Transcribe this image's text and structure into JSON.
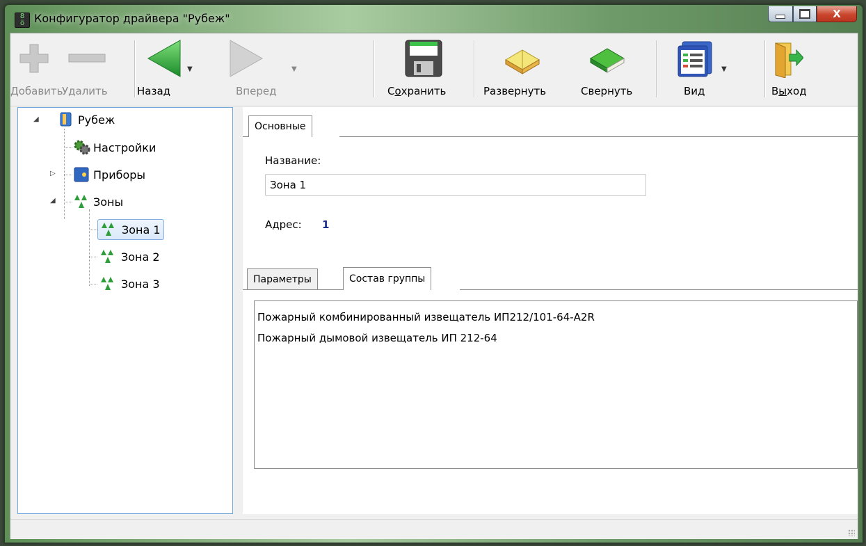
{
  "window": {
    "title": "Конфигуратор драйвера \"Рубеж\"",
    "close_glyph": "X"
  },
  "toolbar": {
    "add": "Добавить",
    "delete": "Удалить",
    "back": "Назад",
    "forward": "Вперед",
    "save_pre": "С",
    "save_u": "о",
    "save_post": "хранить",
    "expand": "Развернуть",
    "collapse": "Свернуть",
    "view": "Вид",
    "exit_pre": "В",
    "exit_u": "ы",
    "exit_post": "ход"
  },
  "tree": {
    "root": "Рубеж",
    "settings": "Настройки",
    "devices": "Приборы",
    "zones": "Зоны",
    "zone_items": [
      "Зона 1",
      "Зона 2",
      "Зона 3"
    ]
  },
  "details": {
    "main_tab": "Основные",
    "name_label": "Название:",
    "name_value": "Зона 1",
    "address_label": "Адрес:",
    "address_value": "1",
    "tab_params": "Параметры",
    "tab_group": "Состав группы",
    "group_items": [
      "Пожарный комбинированный извещатель ИП212/101-64-A2R",
      "Пожарный дымовой извещатель ИП 212-64"
    ]
  },
  "colors": {
    "accent": "#2f9e3a",
    "selection_border": "#84acdd",
    "address_value": "#1b2b8a"
  },
  "icons": [
    "add-icon",
    "delete-icon",
    "back-arrow-icon",
    "forward-arrow-icon",
    "save-floppy-icon",
    "open-book-icon",
    "closed-book-icon",
    "view-list-icon",
    "exit-door-icon",
    "driver-icon",
    "gear-icon",
    "device-icon",
    "zone-icon"
  ]
}
